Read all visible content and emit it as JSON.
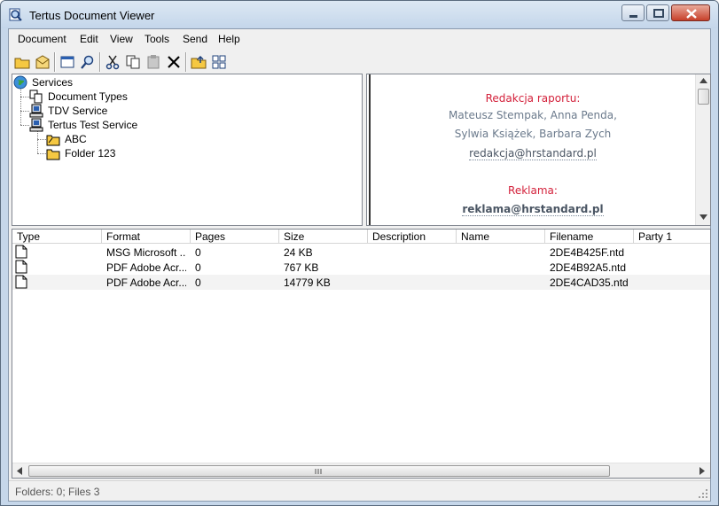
{
  "window": {
    "title": "Tertus Document Viewer"
  },
  "menu": [
    "Document",
    "Edit",
    "View",
    "Tools",
    "Send",
    "Help"
  ],
  "toolbar": {
    "buttons": [
      "open-folder-icon",
      "envelope-icon",
      "window-icon",
      "search-icon",
      "cut-icon",
      "copy-icon",
      "paste-icon",
      "delete-icon",
      "folder-up-icon",
      "grid-icon"
    ]
  },
  "tree": {
    "root": "Services",
    "nodes": [
      "Document Types",
      "TDV Service",
      "Tertus Test Service"
    ],
    "folders": [
      "ABC",
      "Folder 123"
    ]
  },
  "preview": {
    "heading1": "Redakcja raportu:",
    "names1": "Mateusz Stempak, Anna Penda,",
    "names2": "Sylwia Książek, Barbara Zych",
    "email1": "redakcja@hrstandard.pl",
    "heading2": "Reklama:",
    "email2": "reklama@hrstandard.pl"
  },
  "list": {
    "columns": [
      "Type",
      "Format",
      "Pages",
      "Size",
      "Description",
      "Name",
      "Filename",
      "Party 1"
    ],
    "rows": [
      {
        "format": "MSG Microsoft ...",
        "pages": "0",
        "size": "24 KB",
        "description": "",
        "name": "",
        "filename": "2DE4B425F.ntd",
        "party1": ""
      },
      {
        "format": "PDF Adobe Acr...",
        "pages": "0",
        "size": "767 KB",
        "description": "",
        "name": "",
        "filename": "2DE4B92A5.ntd",
        "party1": ""
      },
      {
        "format": "PDF Adobe Acr...",
        "pages": "0",
        "size": "14779 KB",
        "description": "",
        "name": "",
        "filename": "2DE4CAD35.ntd",
        "party1": ""
      }
    ]
  },
  "status": {
    "text": "Folders: 0; Files 3"
  },
  "colors": {
    "accent_red": "#d3203a",
    "preview_grey": "#6b7a8c",
    "folder_yellow": "#f5c842"
  }
}
